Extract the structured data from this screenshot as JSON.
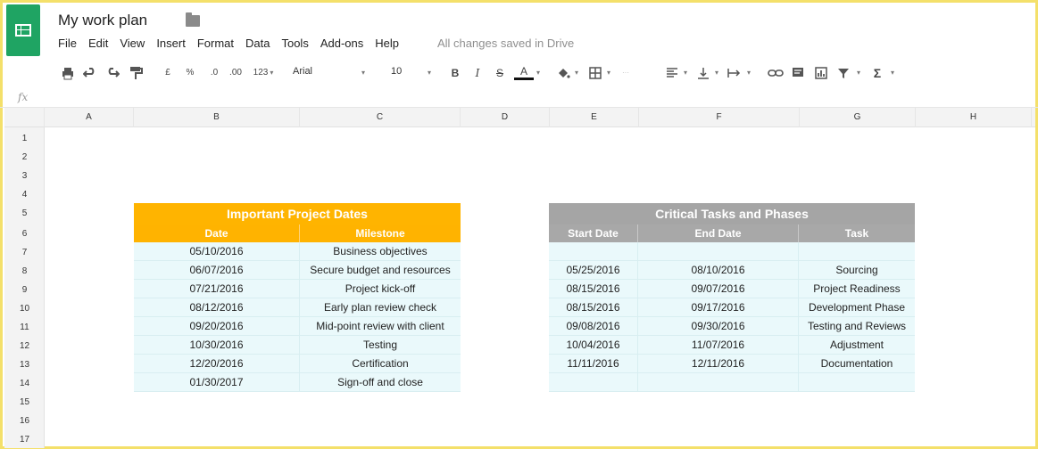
{
  "app": {
    "title": "My work plan",
    "save_status": "All changes saved in Drive",
    "accent_color": "#1fa463"
  },
  "menu": [
    "File",
    "Edit",
    "View",
    "Insert",
    "Format",
    "Data",
    "Tools",
    "Add-ons",
    "Help"
  ],
  "toolbar": {
    "currency": "£",
    "percent": "%",
    "decrease_decimals": ".0",
    "increase_decimals": ".00",
    "more_formats": "123",
    "font": "Arial",
    "font_size": "10",
    "bold": "B",
    "italic": "I",
    "strike": "S",
    "text_color": "A",
    "sum": "Σ"
  },
  "formula_bar": {
    "fx_label": "fx"
  },
  "columns": [
    "A",
    "B",
    "C",
    "D",
    "E",
    "F",
    "G",
    "H"
  ],
  "rows": [
    "1",
    "2",
    "3",
    "4",
    "5",
    "6",
    "7",
    "8",
    "9",
    "10",
    "11",
    "12",
    "13",
    "14",
    "15",
    "16",
    "17"
  ],
  "left_table": {
    "title": "Important Project Dates",
    "title_bg": "#ffb400",
    "header_bg": "#ffb300",
    "headers": [
      "Date",
      "Milestone"
    ],
    "rows": [
      [
        "05/10/2016",
        "Business objectives"
      ],
      [
        "06/07/2016",
        "Secure budget and resources"
      ],
      [
        "07/21/2016",
        "Project kick-off"
      ],
      [
        "08/12/2016",
        "Early plan review check"
      ],
      [
        "09/20/2016",
        "Mid-point review with client"
      ],
      [
        "10/30/2016",
        "Testing"
      ],
      [
        "12/20/2016",
        "Certification"
      ],
      [
        "01/30/2017",
        "Sign-off and close"
      ]
    ]
  },
  "right_table": {
    "title": "Critical Tasks and Phases",
    "title_bg": "#a5a5a5",
    "header_bg": "#a8a8a8",
    "headers": [
      "Start Date",
      "End Date",
      "Task"
    ],
    "rows": [
      [
        "",
        "",
        ""
      ],
      [
        "05/25/2016",
        "08/10/2016",
        "Sourcing"
      ],
      [
        "08/15/2016",
        "09/07/2016",
        "Project Readiness"
      ],
      [
        "08/15/2016",
        "09/17/2016",
        "Development Phase"
      ],
      [
        "09/08/2016",
        "09/30/2016",
        "Testing and Reviews"
      ],
      [
        "10/04/2016",
        "11/07/2016",
        "Adjustment"
      ],
      [
        "11/11/2016",
        "12/11/2016",
        "Documentation"
      ],
      [
        "",
        "",
        ""
      ]
    ]
  }
}
